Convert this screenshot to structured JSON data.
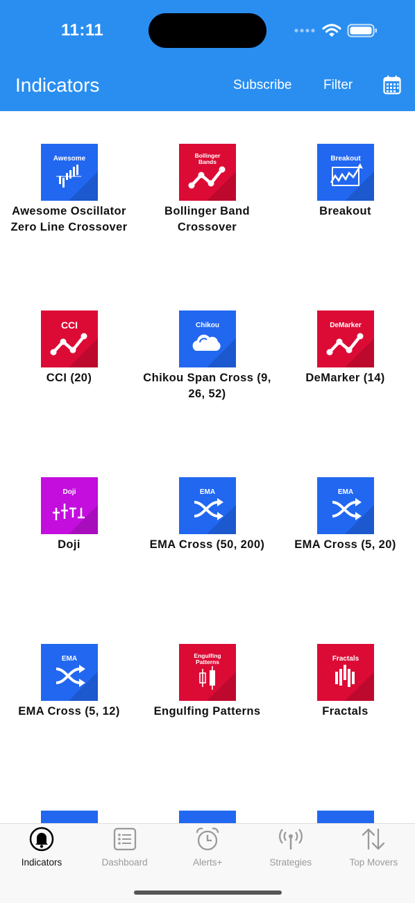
{
  "status_bar": {
    "time": "11:11"
  },
  "nav": {
    "title": "Indicators",
    "subscribe": "Subscribe",
    "filter": "Filter",
    "calendar_icon": "calendar-icon"
  },
  "colors": {
    "header": "#2a8ef0",
    "tile_blue": "#2167f0",
    "tile_red": "#dc0b35",
    "tile_purple": "#c30edd"
  },
  "indicators": [
    {
      "name": "Awesome Oscillator Zero Line Crossover",
      "tile_text": "Awesome",
      "color": "blue",
      "glyph": "bars"
    },
    {
      "name": "Bollinger Band Crossover",
      "tile_text": "Bollinger Bands",
      "color": "red",
      "glyph": "zigzag"
    },
    {
      "name": "Breakout",
      "tile_text": "Breakout",
      "color": "blue",
      "glyph": "breakout"
    },
    {
      "name": "CCI (20)",
      "tile_text": "CCI",
      "color": "red",
      "glyph": "zigzag"
    },
    {
      "name": "Chikou Span Cross (9, 26, 52)",
      "tile_text": "Chikou",
      "color": "blue",
      "glyph": "cloud"
    },
    {
      "name": "DeMarker (14)",
      "tile_text": "DeMarker",
      "color": "red",
      "glyph": "zigzag"
    },
    {
      "name": "Doji",
      "tile_text": "Doji",
      "color": "purple",
      "glyph": "doji"
    },
    {
      "name": "EMA Cross (50, 200)",
      "tile_text": "EMA",
      "color": "blue",
      "glyph": "shuffle"
    },
    {
      "name": "EMA Cross (5, 20)",
      "tile_text": "EMA",
      "color": "blue",
      "glyph": "shuffle"
    },
    {
      "name": "EMA Cross (5, 12)",
      "tile_text": "EMA",
      "color": "blue",
      "glyph": "shuffle"
    },
    {
      "name": "Engulfing Patterns",
      "tile_text": "Engulfing Patterns",
      "color": "red",
      "glyph": "candles"
    },
    {
      "name": "Fractals",
      "tile_text": "Fractals",
      "color": "red",
      "glyph": "fractals"
    },
    {
      "name": "",
      "tile_text": "",
      "color": "blue",
      "glyph": "none"
    },
    {
      "name": "",
      "tile_text": "",
      "color": "blue",
      "glyph": "none"
    },
    {
      "name": "",
      "tile_text": "",
      "color": "blue",
      "glyph": "none"
    }
  ],
  "tabs": [
    {
      "label": "Indicators",
      "icon": "bell-icon",
      "active": true
    },
    {
      "label": "Dashboard",
      "icon": "list-icon",
      "active": false
    },
    {
      "label": "Alerts+",
      "icon": "alarm-clock-icon",
      "active": false
    },
    {
      "label": "Strategies",
      "icon": "broadcast-icon",
      "active": false
    },
    {
      "label": "Top Movers",
      "icon": "up-down-arrows-icon",
      "active": false
    }
  ]
}
